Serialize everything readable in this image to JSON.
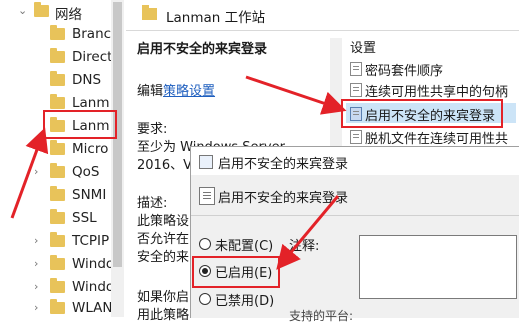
{
  "tree": {
    "items": [
      {
        "label": "网络",
        "expander": "⌄",
        "indent": "top"
      },
      {
        "label": "Branc",
        "expander": ""
      },
      {
        "label": "Direct",
        "expander": ""
      },
      {
        "label": "DNS",
        "expander": ""
      },
      {
        "label": "Lanm",
        "expander": ""
      },
      {
        "label": "Lanm",
        "expander": "",
        "selected": true
      },
      {
        "label": "Micro",
        "expander": "›"
      },
      {
        "label": "QoS",
        "expander": "›"
      },
      {
        "label": "SNMI",
        "expander": ""
      },
      {
        "label": "SSL",
        "expander": ""
      },
      {
        "label": "TCPIP",
        "expander": "›"
      },
      {
        "label": "Windo",
        "expander": "›"
      },
      {
        "label": "Windo",
        "expander": "›"
      },
      {
        "label": "WLAN",
        "expander": "›"
      }
    ]
  },
  "header": {
    "title": "Lanman 工作站"
  },
  "description": {
    "title": "启用不安全的来宾登录",
    "edit_prefix": "编辑",
    "edit_link": "策略设置",
    "requirements_label": "要求:",
    "requirements_line1": "至少为 Windows Server",
    "requirements_line2": "2016、V",
    "desc_label": "描述:",
    "desc_line1": "此策略设",
    "desc_line2": "否允许在",
    "desc_line3": "安全的来",
    "desc_line4": "如果你启",
    "desc_line5": "用此策略"
  },
  "settings": {
    "header": "设置",
    "items": [
      {
        "label": "密码套件顺序"
      },
      {
        "label": "连续可用性共享中的句柄"
      },
      {
        "label": "启用不安全的来宾登录",
        "selected": true
      },
      {
        "label": "脱机文件在连续可用性共"
      }
    ]
  },
  "dialog": {
    "title": "启用不安全的来宾登录",
    "header_text": "启用不安全的来宾登录",
    "options": [
      {
        "label": "未配置(C)",
        "checked": false
      },
      {
        "label": "已启用(E)",
        "checked": true
      },
      {
        "label": "已禁用(D)",
        "checked": false
      }
    ],
    "note_label": "注释:",
    "footer_partial": "支持的平台:"
  },
  "colors": {
    "annotation": "#e32228",
    "folder": "#e8c35a",
    "selection": "#cce4f7"
  }
}
